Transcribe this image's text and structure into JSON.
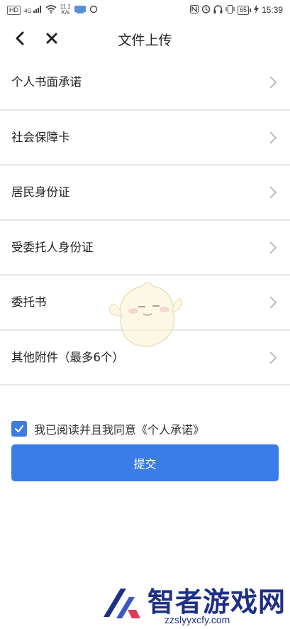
{
  "status_bar": {
    "badge_hd": "HD",
    "signal_label": "4G",
    "speed_value": "11.1",
    "speed_unit": "K/s",
    "battery": "65",
    "time": "15:39"
  },
  "header": {
    "title": "文件上传"
  },
  "items": [
    {
      "label": "个人书面承诺"
    },
    {
      "label": "社会保障卡"
    },
    {
      "label": "居民身份证"
    },
    {
      "label": "受委托人身份证"
    },
    {
      "label": "委托书"
    },
    {
      "label": "其他附件（最多6个）"
    }
  ],
  "agreement": {
    "checked": true,
    "text": "我已阅读并且我同意《个人承诺》"
  },
  "submit": {
    "label": "提交"
  },
  "watermark": {
    "title": "智者游戏网",
    "url": "zzslyyxcfy.com"
  },
  "colors": {
    "accent": "#3a7ce8",
    "divider": "#e6e6e6",
    "watermark": "#1e2f86"
  }
}
